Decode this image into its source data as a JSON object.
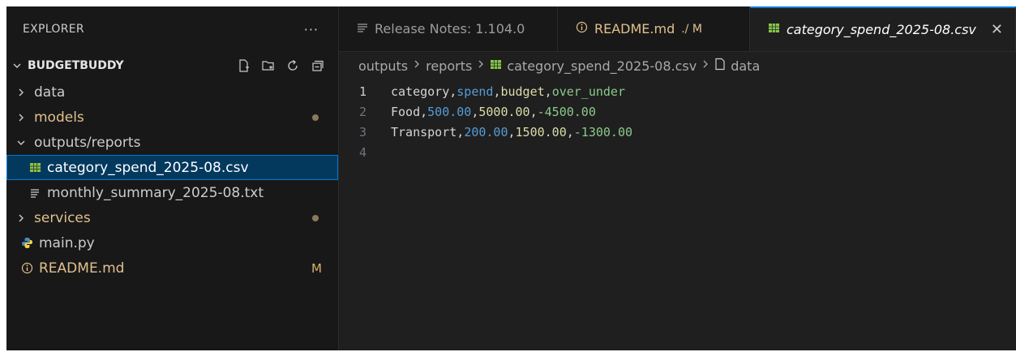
{
  "sidebar": {
    "title": "EXPLORER",
    "more": "···",
    "project": "BUDGETBUDDY",
    "items": [
      {
        "label": "data"
      },
      {
        "label": "models"
      },
      {
        "label": "outputs/reports"
      },
      {
        "label": "category_spend_2025-08.csv"
      },
      {
        "label": "monthly_summary_2025-08.txt"
      },
      {
        "label": "services"
      },
      {
        "label": "main.py"
      },
      {
        "label": "README.md",
        "badge": "M"
      }
    ]
  },
  "tabs": [
    {
      "label": "Release Notes: 1.104.0"
    },
    {
      "label": "README.md",
      "suffix": "./ M"
    },
    {
      "label": "category_spend_2025-08.csv",
      "close": "✕"
    }
  ],
  "breadcrumb": [
    "outputs",
    "reports",
    "category_spend_2025-08.csv",
    "data"
  ],
  "code": {
    "line_numbers": [
      "1",
      "2",
      "3",
      "4"
    ],
    "lines": [
      [
        "category",
        "spend",
        "budget",
        "over_under"
      ],
      [
        "Food",
        "500.00",
        "5000.00",
        "-4500.00"
      ],
      [
        "Transport",
        "200.00",
        "1500.00",
        "-1300.00"
      ]
    ]
  }
}
